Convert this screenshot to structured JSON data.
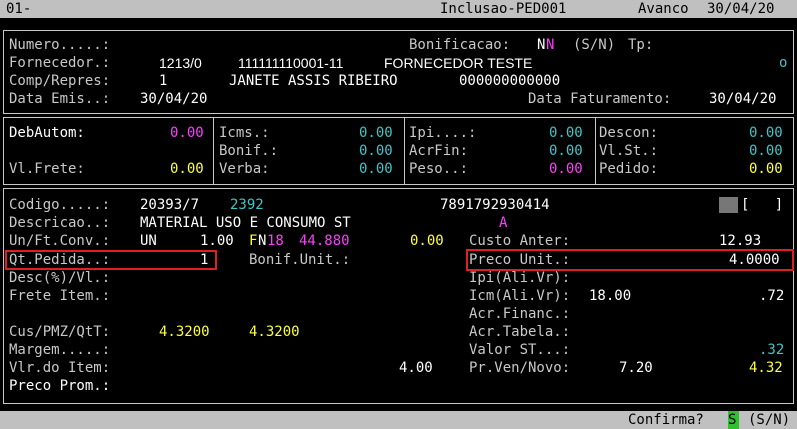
{
  "topbar": {
    "screen_id": "01-",
    "title": "Inclusao-PED001",
    "mode": "Avanco",
    "date": "30/04/20"
  },
  "header": {
    "numero_label": "Numero.....:",
    "bonificacao_label": "Bonificacao:",
    "bonificacao_value": "N",
    "bonificacao_value2": "N",
    "bonificacao_hint": "(S/N)",
    "tp_label": "Tp:",
    "fornecedor_label": "Fornecedor.:",
    "fornecedor_code": "1213/0",
    "fornecedor_doc": "111111110001-11",
    "fornecedor_name": "FORNECEDOR TESTE",
    "fornecedor_flag": "o",
    "comp_label": "Comp/Repres:",
    "comp_code": "1",
    "comp_name": "JANETE ASSIS RIBEIRO",
    "comp_phone": "000000000000",
    "emis_label": "Data Emis..:",
    "emis_value": "30/04/20",
    "fat_label": "Data Faturamento:",
    "fat_value": "30/04/20"
  },
  "totals": {
    "debautom_label": "DebAutom:",
    "debautom_value": "0.00",
    "vlfrete_label": "Vl.Frete:",
    "vlfrete_value": "0.00",
    "icms_label": "Icms.:",
    "icms_value": "0.00",
    "bonif_label": "Bonif.:",
    "bonif_value": "0.00",
    "verba_label": "Verba:",
    "verba_value": "0.00",
    "ipi_label": "Ipi....:",
    "ipi_value": "0.00",
    "acrfin_label": "AcrFin:",
    "acrfin_value": "0.00",
    "peso_label": "Peso..:",
    "peso_value": "0.00",
    "descon_label": "Descon:",
    "descon_value": "0.00",
    "vlst_label": "Vl.St.:",
    "vlst_value": "0.00",
    "pedido_label": "Pedido:",
    "pedido_value": "0.00"
  },
  "item": {
    "codigo_label": "Codigo.....:",
    "codigo_value": "20393/7",
    "codigo_ref": "2392",
    "ean": "7891792930414",
    "bracket": "[   ]",
    "descricao_label": "Descricao..:",
    "descricao_value": "MATERIAL USO E CONSUMO ST",
    "descricao_flag": "A",
    "unft_label": "Un/Ft.Conv.:",
    "unft_un": "UN",
    "unft_conv": "1.00",
    "fn_f": "F",
    "fn_n": "N",
    "fn_code": "18",
    "fn_value": "44.880",
    "unft_extra": "0.00",
    "custo_label": "Custo Anter:",
    "custo_value": "12.93",
    "qtped_label": "Qt.Pedida..:",
    "qtped_value": "1",
    "bonifunit_label": "Bonif.Unit.:",
    "precounit_label": "Preco Unit.:",
    "precounit_value": "4.0000",
    "desc_label": "Desc(%)/Vl.:",
    "ipialivr_label": "Ipi(Ali.Vr):",
    "frete_label": "Frete Item.:",
    "icmalivr_label": "Icm(Ali.Vr):",
    "icmalivr_aliq": "18.00",
    "icmalivr_value": ".72",
    "acrfinanc_label": "Acr.Financ.:",
    "cuspmz_label": "Cus/PMZ/QtT:",
    "cuspmz_v1": "4.3200",
    "cuspmz_v2": "4.3200",
    "acrtabela_label": "Acr.Tabela.:",
    "margem_label": "Margem.....:",
    "valorst_label": "Valor ST...:",
    "valorst_value": ".32",
    "vlritem_label": "Vlr.do Item:",
    "vlritem_value": "4.00",
    "prven_label": "Pr.Ven/Novo:",
    "prven_v1": "7.20",
    "prven_v2": "4.32",
    "precoprom_label": "Preco Prom.:"
  },
  "footer": {
    "prompt": "Confirma?",
    "answer": "S",
    "hint": "(S/N)"
  }
}
